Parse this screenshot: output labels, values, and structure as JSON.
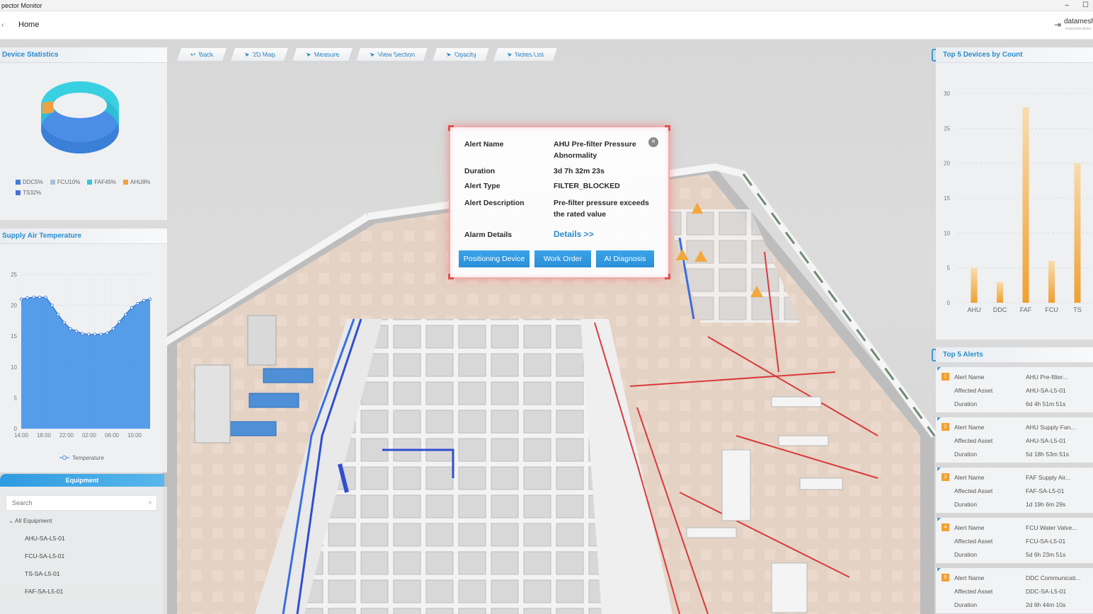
{
  "window": {
    "title": "pector Monitor",
    "minimize": "–",
    "maximize": "☐"
  },
  "header": {
    "home": "Home",
    "user": "datamesh",
    "user_sub": "inspection-demo"
  },
  "toolbar": [
    {
      "label": "Back",
      "icon": "↩"
    },
    {
      "label": "2D Map",
      "icon": "➤"
    },
    {
      "label": "Measure",
      "icon": "➤"
    },
    {
      "label": "View Section",
      "icon": "➤"
    },
    {
      "label": "Opacity",
      "icon": "➤"
    },
    {
      "label": "Notes List",
      "icon": "➤"
    }
  ],
  "device_stats": {
    "title": "Device Statistics",
    "legend": [
      {
        "label": "DDC5%",
        "color": "#3a7fd8"
      },
      {
        "label": "FCU10%",
        "color": "#a8bfd8"
      },
      {
        "label": "FAF45%",
        "color": "#35c5d8"
      },
      {
        "label": "AHU8%",
        "color": "#f0a040"
      },
      {
        "label": "TS32%",
        "color": "#4a6fd8"
      }
    ]
  },
  "supply_air": {
    "title": "Supply Air Temperature",
    "legend": "Temperature"
  },
  "equipment": {
    "tab": "Equipment",
    "search_placeholder": "Search",
    "root": "All Equipment",
    "items": [
      "AHU-SA-L5-01",
      "FCU-SA-L5-01",
      "TS-SA-L5-01",
      "FAF-SA-L5-01"
    ]
  },
  "alert_popup": {
    "rows": [
      {
        "label": "Alert Name",
        "value": "AHU Pre-filter Pressure Abnormality"
      },
      {
        "label": "Duration",
        "value": "3d 7h 32m 23s"
      },
      {
        "label": "Alert Type",
        "value": "FILTER_BLOCKED"
      },
      {
        "label": "Alert Description",
        "value": "Pre-filter pressure exceeds the rated value"
      },
      {
        "label": "Alarm Details",
        "value": "Details >>"
      }
    ],
    "buttons": [
      "Positioning Device",
      "Work Order",
      "AI Diagnosis"
    ]
  },
  "top_devices": {
    "title": "Top 5 Devices by Count"
  },
  "top_alerts": {
    "title": "Top 5 Alerts",
    "keys": [
      "Alert Name",
      "Affected Asset",
      "Duration"
    ],
    "items": [
      {
        "num": "1",
        "name": "AHU Pre-filter...",
        "asset": "AHU-SA-L5-01",
        "duration": "6d 4h 51m 51s"
      },
      {
        "num": "2",
        "name": "AHU Supply Fan...",
        "asset": "AHU-SA-L5-01",
        "duration": "5d 18h 53m 51s"
      },
      {
        "num": "3",
        "name": "FAF Supply Air...",
        "asset": "FAF-SA-L5-01",
        "duration": "1d 19h 6m 29s"
      },
      {
        "num": "4",
        "name": "FCU Water Valve...",
        "asset": "FCU-SA-L5-01",
        "duration": "5d 6h 23m 51s"
      },
      {
        "num": "5",
        "name": "DDC Communicati...",
        "asset": "DDC-SA-L5-01",
        "duration": "2d 6h 44m 10s"
      }
    ]
  },
  "chart_data": [
    {
      "type": "pie",
      "categories": [
        "DDC",
        "FCU",
        "FAF",
        "AHU",
        "TS"
      ],
      "values": [
        5,
        10,
        45,
        8,
        32
      ]
    },
    {
      "type": "area",
      "title": "Supply Air Temperature",
      "x_ticks": [
        "14:00",
        "18:00",
        "22:00",
        "02:00",
        "06:00",
        "10:00"
      ],
      "y_ticks": [
        0,
        5,
        10,
        15,
        20,
        25
      ],
      "ylim": [
        0,
        25
      ],
      "series": [
        {
          "name": "Temperature",
          "values": [
            21,
            21.2,
            21.3,
            21.3,
            21.3,
            20,
            18.5,
            17.2,
            16.2,
            15.8,
            15.4,
            15.3,
            15.3,
            15.3,
            15.5,
            16.2,
            17.3,
            18.5,
            19.6,
            20.3,
            20.8,
            21
          ]
        }
      ],
      "color": "#3a8ee6"
    },
    {
      "type": "bar",
      "title": "Top 5 Devices by Count",
      "categories": [
        "AHU",
        "DDC",
        "FAF",
        "FCU",
        "TS"
      ],
      "values": [
        5,
        3,
        28,
        6,
        20
      ],
      "y_ticks": [
        0,
        5,
        10,
        15,
        20,
        25,
        30
      ],
      "ylim": [
        0,
        30
      ],
      "color": "#f0a030"
    }
  ]
}
